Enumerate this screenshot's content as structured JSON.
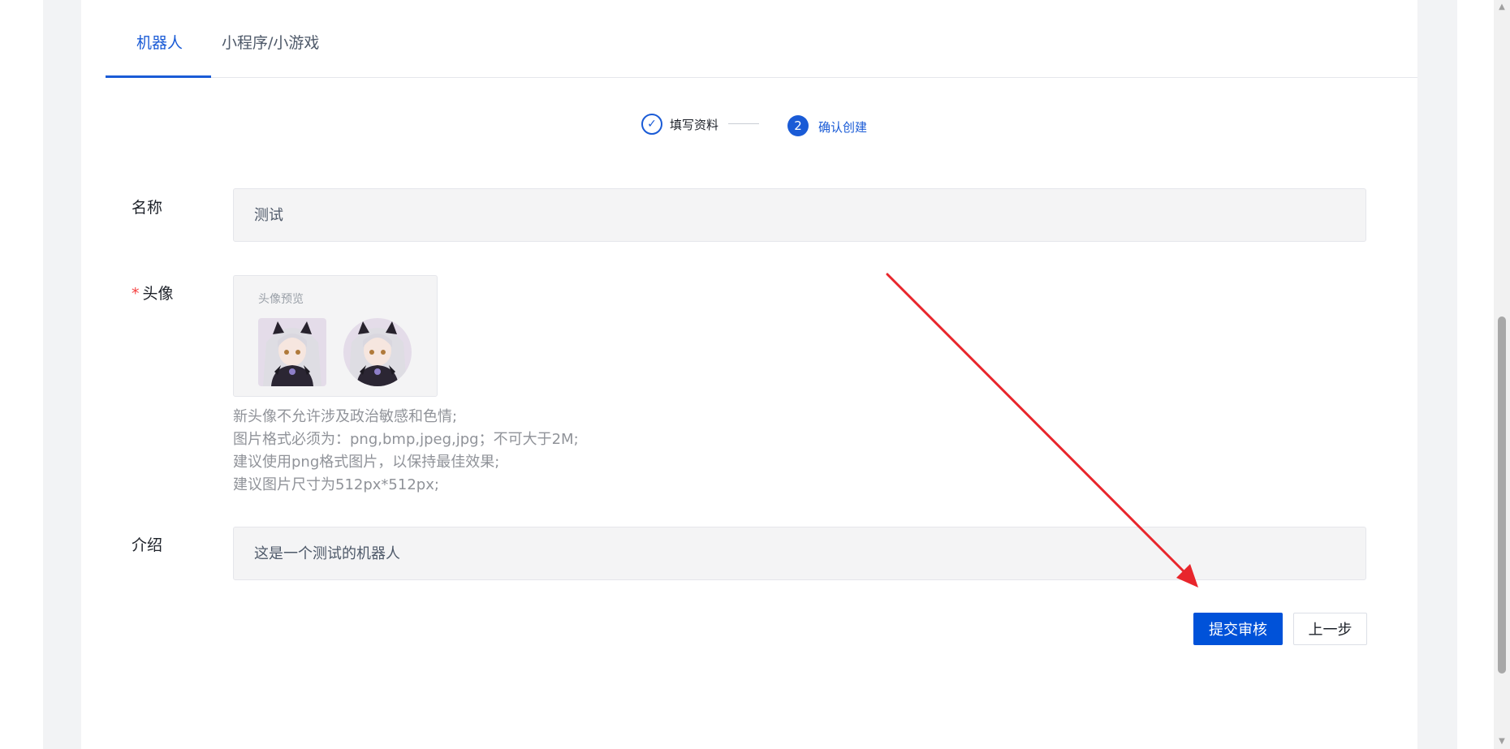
{
  "tabs": [
    {
      "label": "机器人",
      "active": true
    },
    {
      "label": "小程序/小游戏",
      "active": false
    }
  ],
  "steps": [
    {
      "label": "填写资料",
      "status": "done",
      "icon": "check-icon"
    },
    {
      "label": "确认创建",
      "status": "current",
      "number": "2"
    }
  ],
  "form": {
    "name_label": "名称",
    "name_value": "测试",
    "avatar_required_mark": "*",
    "avatar_label": "头像",
    "avatar_preview_caption": "头像预览",
    "avatar_tips": [
      "新头像不允许涉及政治敏感和色情;",
      "图片格式必须为：png,bmp,jpeg,jpg；不可大于2M;",
      "建议使用png格式图片，以保持最佳效果;",
      "建议图片尺寸为512px*512px;"
    ],
    "intro_label": "介绍",
    "intro_value": "这是一个测试的机器人"
  },
  "actions": {
    "submit_label": "提交审核",
    "prev_label": "上一步"
  },
  "colors": {
    "accent": "#1a5bd6",
    "primary_button": "#0052d9",
    "annotation_arrow": "#e8262c",
    "required": "#f53f3f"
  }
}
